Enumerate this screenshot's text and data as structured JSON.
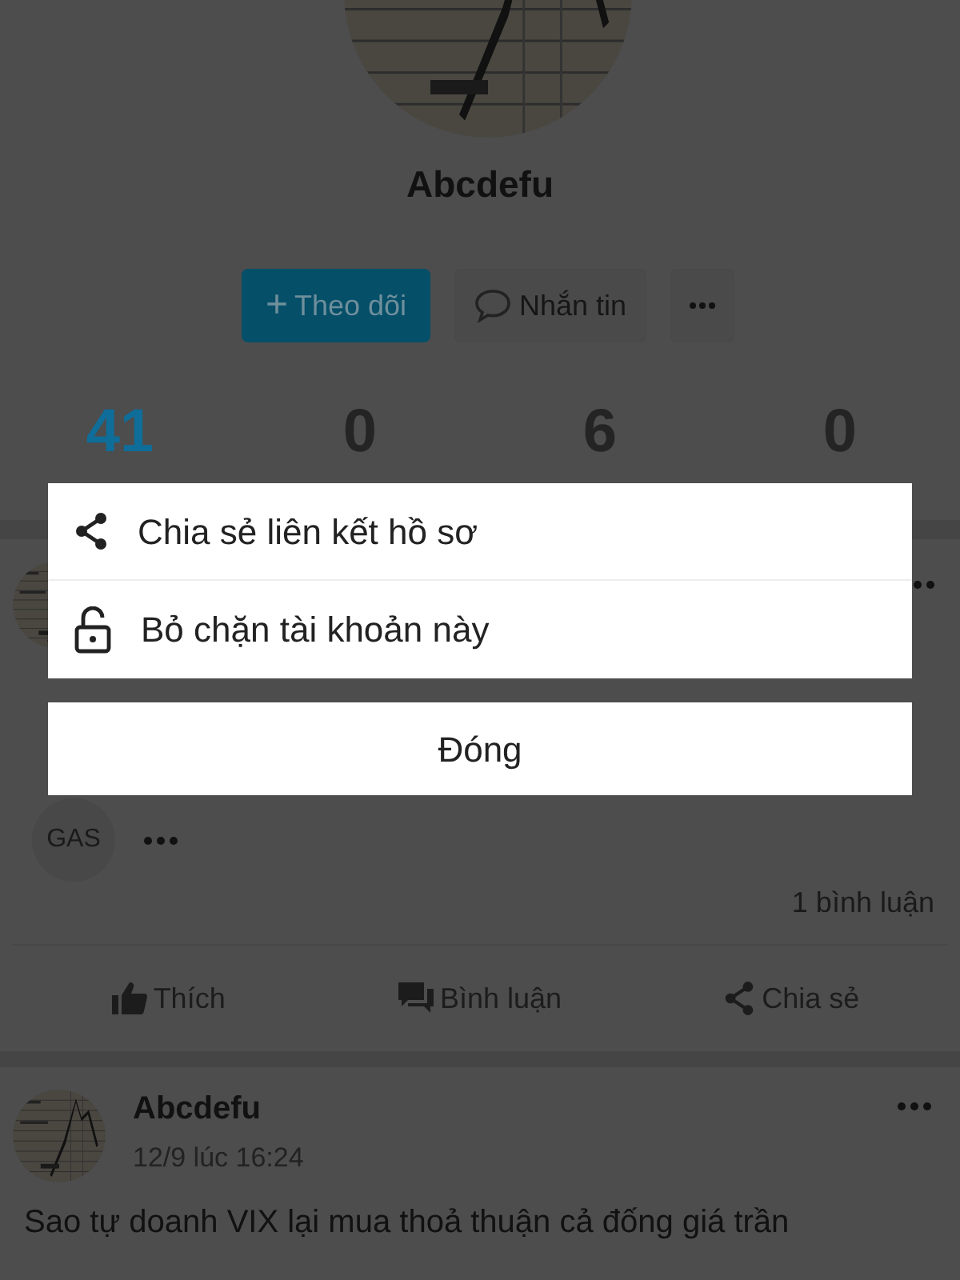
{
  "profile": {
    "avatar": {
      "kind": "picture"
    },
    "name": "Abcdefu",
    "buttons": [
      {
        "kind": "follow",
        "icon": "+",
        "label": "Theo dõi"
      },
      {
        "kind": "message",
        "label": "Nhắn tin"
      },
      {
        "kind": "more"
      }
    ],
    "stats": [
      {
        "value": "41",
        "selected": true
      },
      {
        "value": "0",
        "selected": false
      },
      {
        "value": "6",
        "selected": false
      },
      {
        "value": "0",
        "selected": false
      }
    ]
  },
  "posts": [
    {
      "avatar": {
        "kind": "picture"
      },
      "tag": "GAS",
      "comments": "1 bình luận",
      "actions": [
        {
          "kind": "like",
          "label": "Thích"
        },
        {
          "kind": "comment",
          "label": "Bình luận"
        },
        {
          "kind": "share",
          "label": "Chia sẻ"
        }
      ]
    },
    {
      "avatar": {
        "kind": "picture"
      },
      "author": "Abcdefu",
      "time": "12/9 lúc 16:24",
      "text": "Sao tự doanh VIX lại mua thoả thuận cả đống giá trần"
    }
  ],
  "sheet": {
    "items": [
      {
        "kind": "share",
        "label": "Chia sẻ liên kết hồ sơ"
      },
      {
        "kind": "unlock",
        "label": "Bỏ chặn tài khoản này"
      }
    ],
    "close": "Đóng"
  }
}
